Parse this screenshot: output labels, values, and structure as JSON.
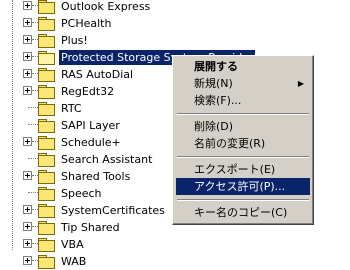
{
  "tree": {
    "items": [
      {
        "label": "Outlook Express",
        "expandable": true
      },
      {
        "label": "PCHealth",
        "expandable": true
      },
      {
        "label": "Plus!",
        "expandable": true
      },
      {
        "label": "Protected Storage System Provider",
        "expandable": true,
        "selected": true
      },
      {
        "label": "RAS AutoDial",
        "expandable": true
      },
      {
        "label": "RegEdt32",
        "expandable": true
      },
      {
        "label": "RTC",
        "expandable": false
      },
      {
        "label": "SAPI Layer",
        "expandable": false
      },
      {
        "label": "Schedule+",
        "expandable": true
      },
      {
        "label": "Search Assistant",
        "expandable": false
      },
      {
        "label": "Shared Tools",
        "expandable": true
      },
      {
        "label": "Speech",
        "expandable": false
      },
      {
        "label": "SystemCertificates",
        "expandable": true
      },
      {
        "label": "Tip Shared",
        "expandable": true
      },
      {
        "label": "VBA",
        "expandable": true
      },
      {
        "label": "WAB",
        "expandable": true
      }
    ]
  },
  "context_menu": {
    "expand": "展開する",
    "new": "新規(N)",
    "find": "検索(F)...",
    "delete": "削除(D)",
    "rename": "名前の変更(R)",
    "export": "エクスポート(E)",
    "permissions": "アクセス許可(P)...",
    "copy_key_name": "キー名のコピー(C)"
  },
  "colors": {
    "selection": "#0a246a",
    "menu_bg": "#d4d0c8",
    "folder": "#fbe778"
  }
}
